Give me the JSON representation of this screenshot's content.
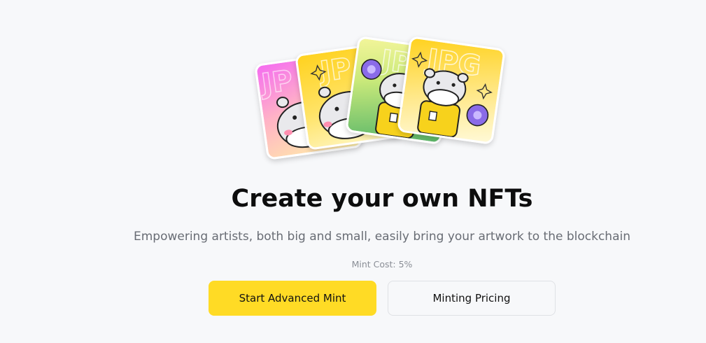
{
  "hero": {
    "illustration": "nft-card-stack",
    "card_overlay_text": "JPG"
  },
  "title": "Create your own NFTs",
  "subtitle": "Empowering artists, both big and small, easily bring your artwork to the blockchain",
  "mint_cost": "Mint Cost: 5%",
  "actions": {
    "primary_label": "Start Advanced Mint",
    "secondary_label": "Minting Pricing"
  },
  "colors": {
    "background": "#f7f8fa",
    "primary_button": "#ffdb25",
    "title_text": "#0d0d0d",
    "subtitle_text": "#686c74"
  }
}
